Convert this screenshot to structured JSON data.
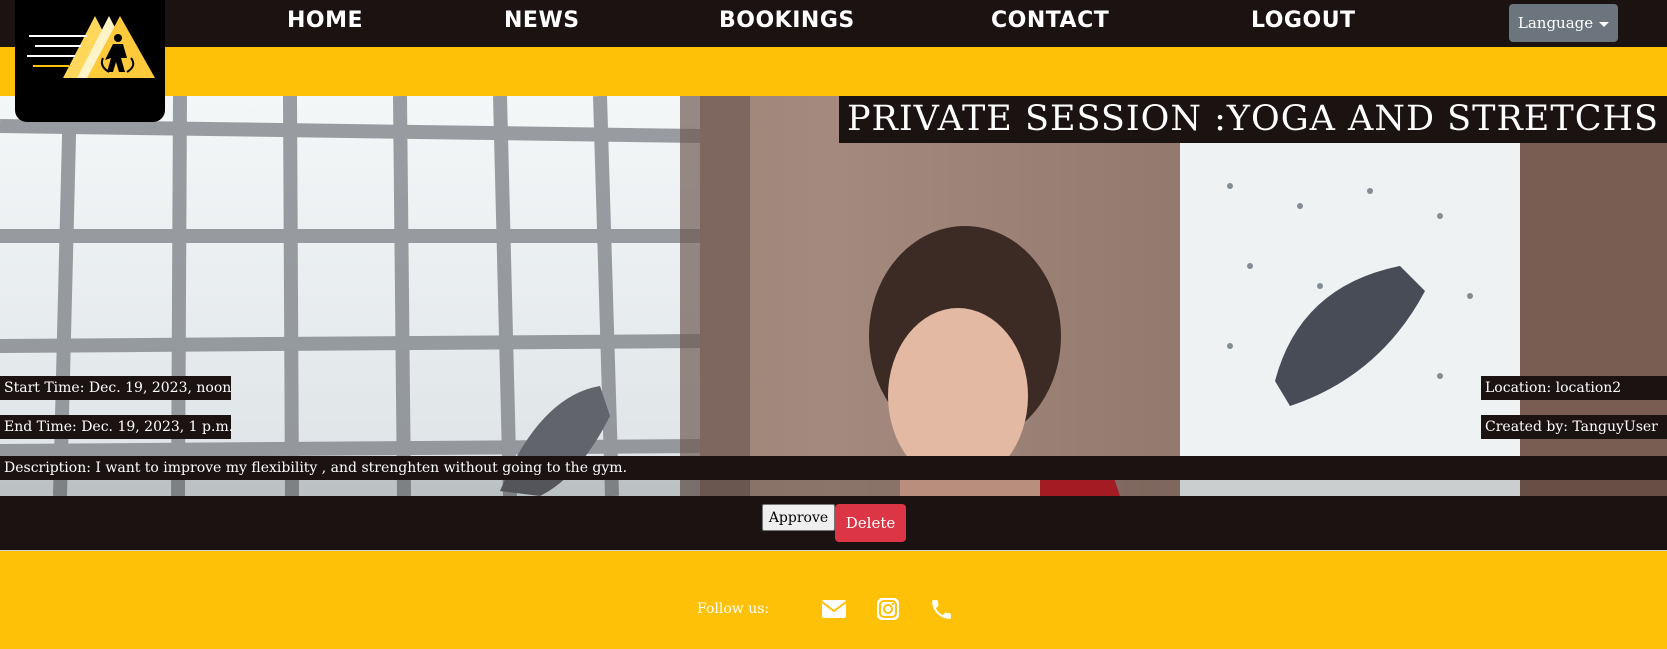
{
  "nav": {
    "home": "HOME",
    "news": "NEWS",
    "bookings": "BOOKINGS",
    "contact": "CONTACT",
    "logout": "LOGOUT",
    "language": "Language"
  },
  "session": {
    "title": "PRIVATE SESSION :YOGA AND STRETCHS",
    "start_time": "Start Time: Dec. 19, 2023, noon",
    "end_time": "End Time: Dec. 19, 2023, 1 p.m.",
    "location": "Location: location2",
    "created_by": "Created by: TanguyUser",
    "description": "Description: I want to improve my flexibility , and strenghten without going to the gym."
  },
  "actions": {
    "approve": "Approve",
    "delete": "Delete"
  },
  "footer": {
    "follow_label": "Follow us:",
    "icons": [
      "envelope-icon",
      "instagram-icon",
      "phone-icon"
    ]
  },
  "colors": {
    "nav_bg": "#1b1212",
    "accent_yellow": "#ffc107",
    "delete_red": "#dc3545",
    "language_gray": "#6c757d"
  }
}
